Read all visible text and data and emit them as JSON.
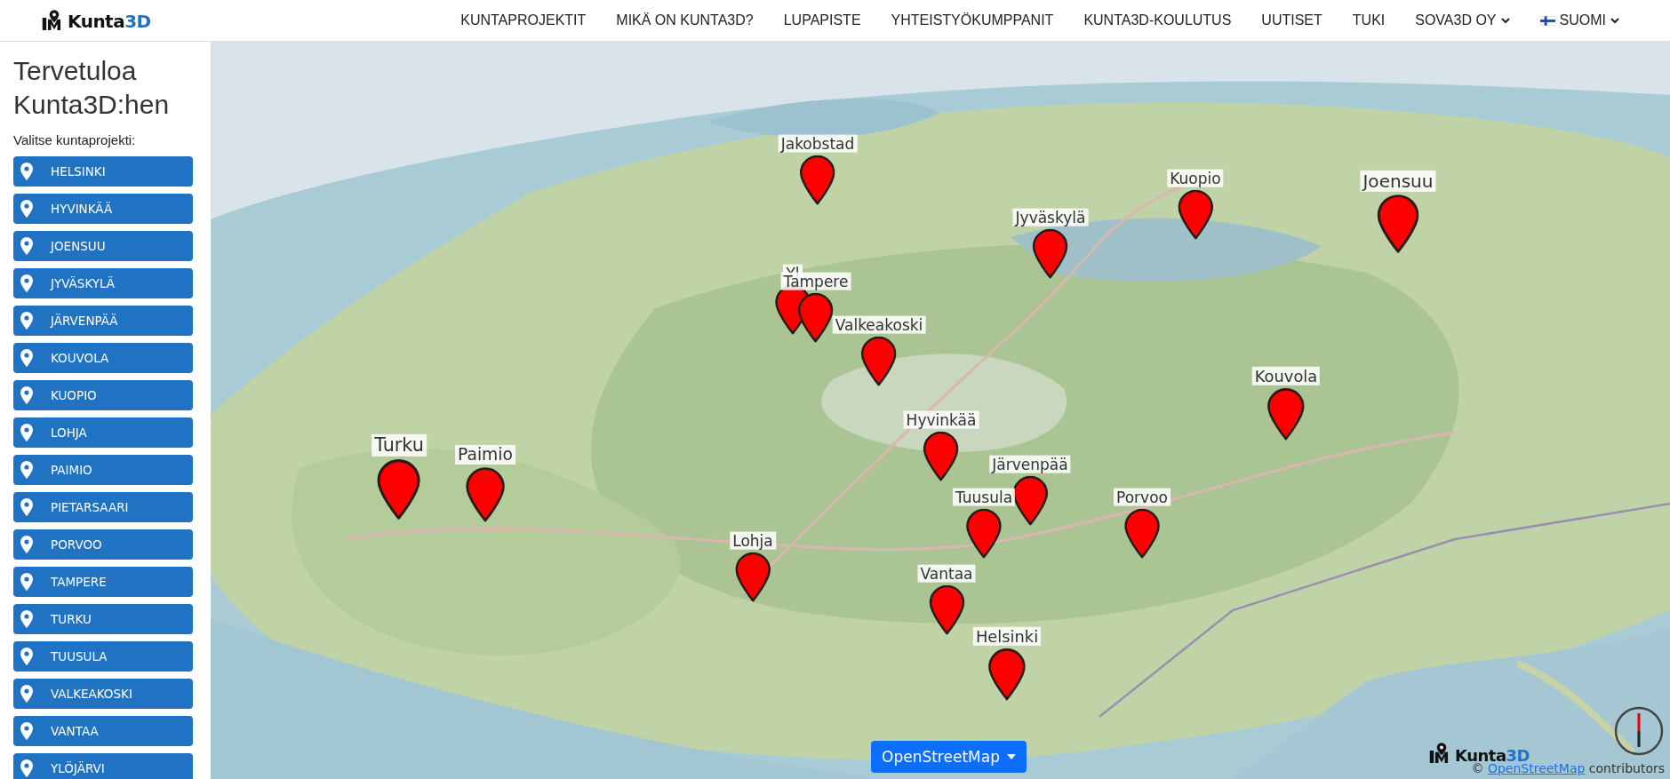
{
  "header": {
    "logo": {
      "text": "Kunta",
      "accent": "3D"
    },
    "nav": [
      {
        "label": "KUNTAPROJEKTIT",
        "dropdown": false
      },
      {
        "label": "MIKÄ ON KUNTA3D?",
        "dropdown": false
      },
      {
        "label": "LUPAPISTE",
        "dropdown": false
      },
      {
        "label": "YHTEISTYÖKUMPPANIT",
        "dropdown": false
      },
      {
        "label": "KUNTA3D-KOULUTUS",
        "dropdown": false
      },
      {
        "label": "UUTISET",
        "dropdown": false
      },
      {
        "label": "TUKI",
        "dropdown": false
      },
      {
        "label": "SOVA3D OY",
        "dropdown": true
      },
      {
        "label": "SUOMI",
        "dropdown": true,
        "flag": true
      }
    ]
  },
  "sidebar": {
    "title": "Tervetuloa Kunta3D:hen",
    "prompt": "Valitse kuntaprojekti:",
    "items": [
      "HELSINKI",
      "HYVINKÄÄ",
      "JOENSUU",
      "JYVÄSKYLÄ",
      "JÄRVENPÄÄ",
      "KOUVOLA",
      "KUOPIO",
      "LOHJA",
      "PAIMIO",
      "PIETARSAARI",
      "PORVOO",
      "TAMPERE",
      "TURKU",
      "TUUSULA",
      "VALKEAKOSKI",
      "VANTAA",
      "YLÖJÄRVI"
    ]
  },
  "map": {
    "markers": [
      {
        "label": "Jakobstad"
      },
      {
        "label": "Kuopio"
      },
      {
        "label": "Joensuu"
      },
      {
        "label": "Jyväskylä"
      },
      {
        "label": "Yl"
      },
      {
        "label": "Tampere"
      },
      {
        "label": "Valkeakoski"
      },
      {
        "label": "Kouvola"
      },
      {
        "label": "Turku"
      },
      {
        "label": "Paimio"
      },
      {
        "label": "Hyvinkää"
      },
      {
        "label": "Järvenpää"
      },
      {
        "label": "Tuusula"
      },
      {
        "label": "Porvoo"
      },
      {
        "label": "Lohja"
      },
      {
        "label": "Vantaa"
      },
      {
        "label": "Helsinki"
      }
    ],
    "layer_button": "OpenStreetMap",
    "logo": {
      "text": "Kunta",
      "accent": "3D"
    },
    "attribution": {
      "prefix": "©",
      "link": "OpenStreetMap",
      "suffix": "contributors"
    }
  }
}
